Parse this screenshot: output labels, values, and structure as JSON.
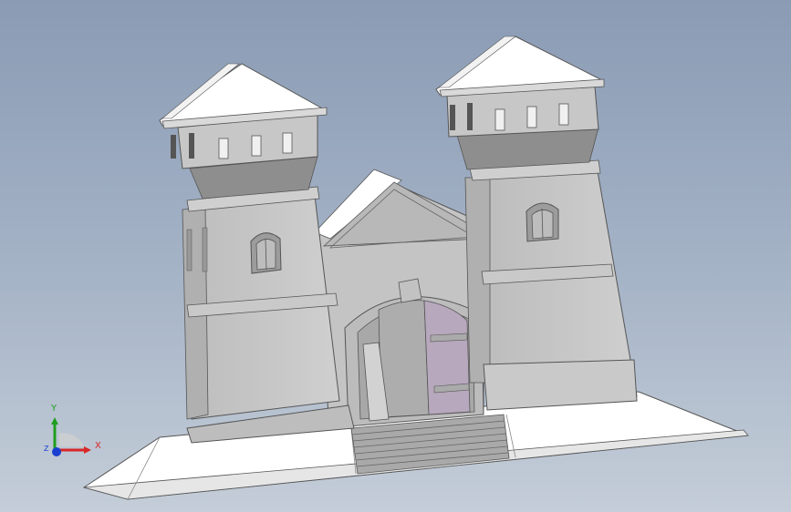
{
  "triad": {
    "x_label": "X",
    "y_label": "Y",
    "z_label": "Z",
    "x_color": "#d92626",
    "y_color": "#1f9e1f",
    "z_color": "#1a3fd0"
  },
  "background": {
    "top": "#8a9bb4",
    "bottom": "#c4cdd8"
  },
  "model": {
    "wall_color": "#c8c8c8",
    "shadow_color": "#8e8e8e",
    "roof_color": "#ffffff",
    "door_glass_color": "#b7a8bd"
  }
}
